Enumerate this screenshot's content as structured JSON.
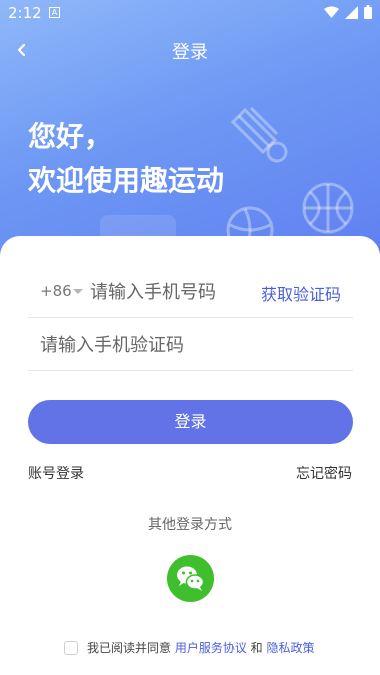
{
  "status_bar": {
    "time": "2:12",
    "notification_icon": "a-box-icon",
    "icons": [
      "wifi-icon",
      "signal-icon",
      "battery-icon"
    ]
  },
  "nav": {
    "back_icon": "chevron-left-icon",
    "title": "登录"
  },
  "hero": {
    "greeting_line1": "您好，",
    "greeting_line2": "欢迎使用趣运动",
    "decorations": [
      "shuttlecock-icon",
      "basketball-icon",
      "ball-icon"
    ]
  },
  "form": {
    "country_code": "+86",
    "phone_placeholder": "请输入手机号码",
    "get_code_label": "获取验证码",
    "code_placeholder": "请输入手机验证码",
    "login_label": "登录",
    "account_login_label": "账号登录",
    "forgot_password_label": "忘记密码"
  },
  "other_login": {
    "title": "其他登录方式",
    "wechat_icon": "wechat-icon"
  },
  "agreement": {
    "prefix": "我已阅读并同意 ",
    "terms_label": "用户服务协议",
    "connector": " 和 ",
    "privacy_label": "隐私政策",
    "checked": false
  },
  "colors": {
    "primary": "#6173e6",
    "link": "#4a5fdc",
    "wechat": "#3fbf2e",
    "hero_start": "#8fb8f9",
    "hero_end": "#5f7ff0"
  }
}
